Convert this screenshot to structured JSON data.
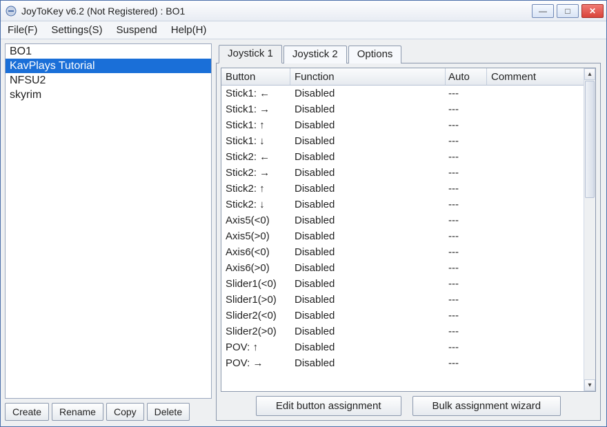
{
  "window": {
    "title": "JoyToKey v6.2 (Not Registered) : BO1"
  },
  "menu": {
    "file": "File(F)",
    "settings": "Settings(S)",
    "suspend": "Suspend",
    "help": "Help(H)"
  },
  "profiles": [
    {
      "name": "BO1",
      "selected": false
    },
    {
      "name": "KavPlays Tutorial",
      "selected": true
    },
    {
      "name": "NFSU2",
      "selected": false
    },
    {
      "name": "skyrim",
      "selected": false
    }
  ],
  "left_buttons": {
    "create": "Create",
    "rename": "Rename",
    "copy": "Copy",
    "delete": "Delete"
  },
  "tabs": {
    "joy1": "Joystick 1",
    "joy2": "Joystick 2",
    "options": "Options",
    "active_tab": "Joystick 1"
  },
  "grid": {
    "headers": {
      "button": "Button",
      "function": "Function",
      "auto": "Auto",
      "comment": "Comment"
    },
    "rows": [
      {
        "button": "Stick1: ←",
        "function": "Disabled",
        "auto": "---",
        "comment": ""
      },
      {
        "button": "Stick1: →",
        "function": "Disabled",
        "auto": "---",
        "comment": ""
      },
      {
        "button": "Stick1: ↑",
        "function": "Disabled",
        "auto": "---",
        "comment": ""
      },
      {
        "button": "Stick1: ↓",
        "function": "Disabled",
        "auto": "---",
        "comment": ""
      },
      {
        "button": "Stick2: ←",
        "function": "Disabled",
        "auto": "---",
        "comment": ""
      },
      {
        "button": "Stick2: →",
        "function": "Disabled",
        "auto": "---",
        "comment": ""
      },
      {
        "button": "Stick2: ↑",
        "function": "Disabled",
        "auto": "---",
        "comment": ""
      },
      {
        "button": "Stick2: ↓",
        "function": "Disabled",
        "auto": "---",
        "comment": ""
      },
      {
        "button": "Axis5(<0)",
        "function": "Disabled",
        "auto": "---",
        "comment": ""
      },
      {
        "button": "Axis5(>0)",
        "function": "Disabled",
        "auto": "---",
        "comment": ""
      },
      {
        "button": "Axis6(<0)",
        "function": "Disabled",
        "auto": "---",
        "comment": ""
      },
      {
        "button": "Axis6(>0)",
        "function": "Disabled",
        "auto": "---",
        "comment": ""
      },
      {
        "button": "Slider1(<0)",
        "function": "Disabled",
        "auto": "---",
        "comment": ""
      },
      {
        "button": "Slider1(>0)",
        "function": "Disabled",
        "auto": "---",
        "comment": ""
      },
      {
        "button": "Slider2(<0)",
        "function": "Disabled",
        "auto": "---",
        "comment": ""
      },
      {
        "button": "Slider2(>0)",
        "function": "Disabled",
        "auto": "---",
        "comment": ""
      },
      {
        "button": "POV: ↑",
        "function": "Disabled",
        "auto": "---",
        "comment": ""
      },
      {
        "button": "POV: →",
        "function": "Disabled",
        "auto": "---",
        "comment": ""
      }
    ]
  },
  "bottom_buttons": {
    "edit": "Edit button assignment",
    "bulk": "Bulk assignment wizard"
  }
}
